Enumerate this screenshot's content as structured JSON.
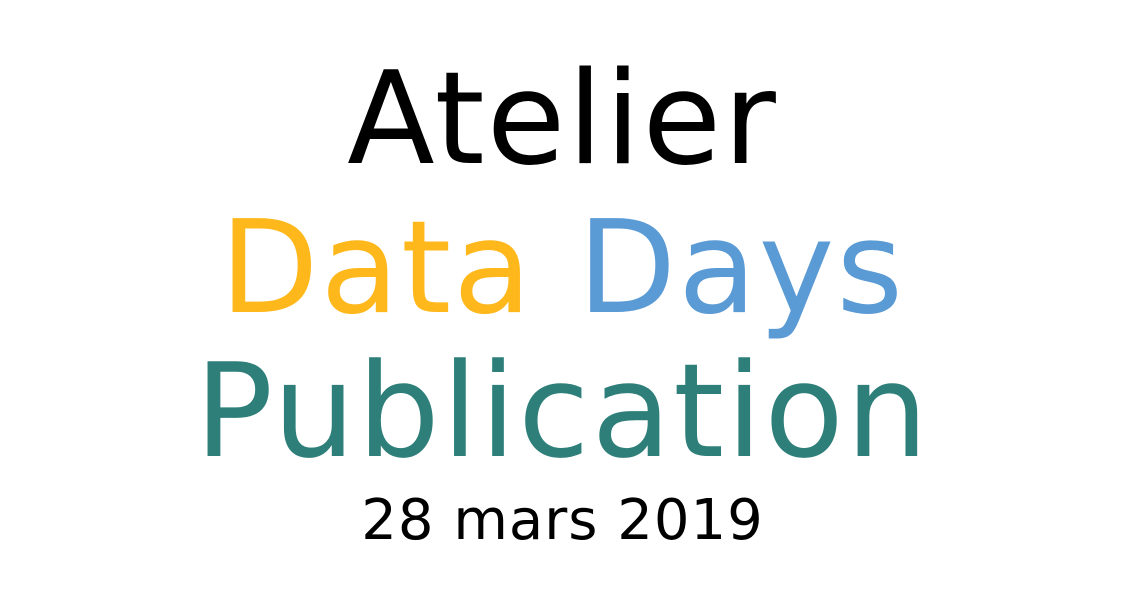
{
  "title": {
    "line1": "Atelier",
    "line2_word1": "Data",
    "line2_word2": "Days",
    "line3": "Publication"
  },
  "date": "28 mars 2019",
  "colors": {
    "line1": "#000000",
    "data_word": "#FFB81C",
    "days_word": "#5B9BD5",
    "publication": "#2E7F7A",
    "date": "#000000",
    "background": "#FFFFFF"
  }
}
